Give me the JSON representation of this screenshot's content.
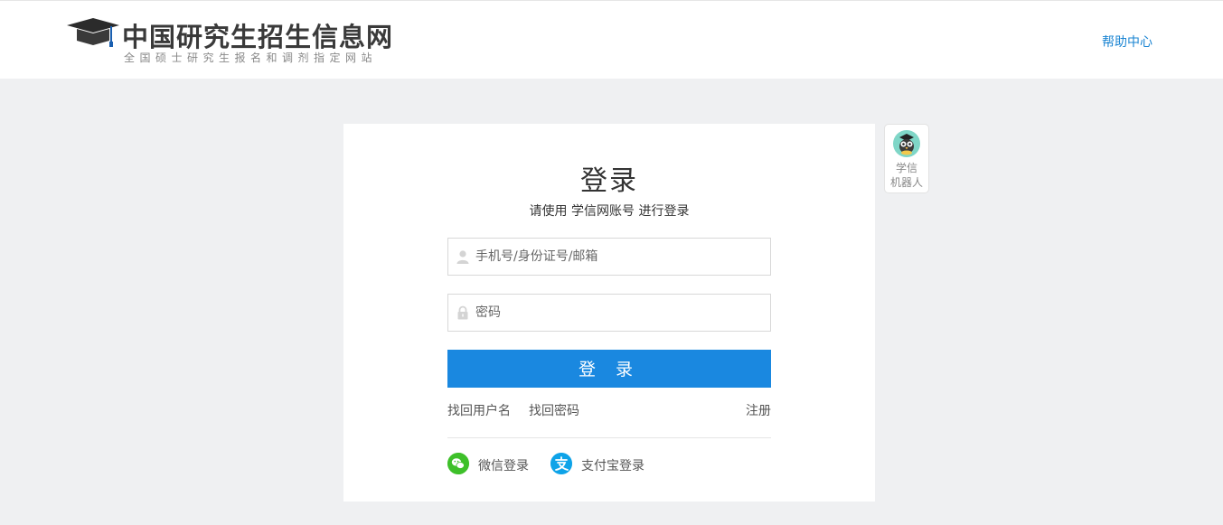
{
  "header": {
    "logo_title": "中国研究生招生信息网",
    "logo_subtitle": "全国硕士研究生报名和调剂指定网站",
    "help_link": "帮助中心"
  },
  "login": {
    "title": "登录",
    "subtitle": "请使用 学信网账号 进行登录",
    "username_placeholder": "手机号/身份证号/邮箱",
    "password_placeholder": "密码",
    "submit_label": "登 录",
    "find_username": "找回用户名",
    "find_password": "找回密码",
    "register": "注册",
    "wechat_login": "微信登录",
    "alipay_login": "支付宝登录"
  },
  "robot": {
    "label_line1": "学信",
    "label_line2": "机器人"
  },
  "colors": {
    "accent": "#1a88e0",
    "link": "#1a84d2",
    "wechat": "#3ec02a",
    "alipay": "#0ea3e8",
    "page_bg": "#eff0f2"
  },
  "icons": {
    "logo": "graduation-cap-icon",
    "username": "user-icon",
    "password": "lock-icon",
    "wechat": "wechat-icon",
    "alipay": "alipay-icon",
    "robot": "robot-owl-icon"
  }
}
